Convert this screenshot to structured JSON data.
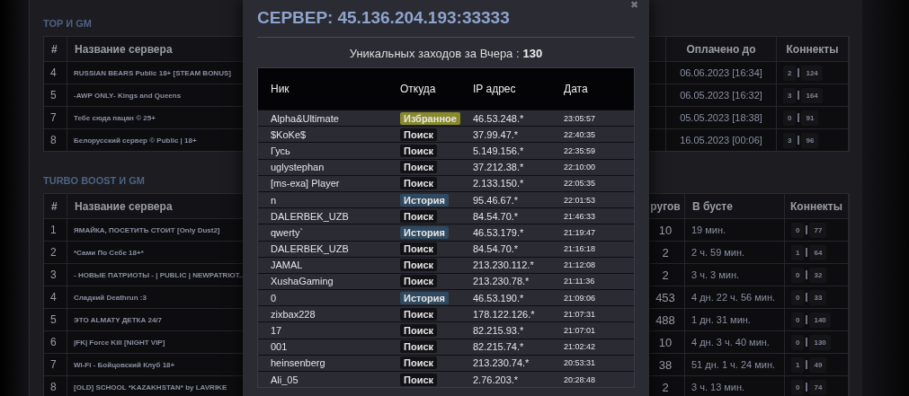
{
  "sections": [
    {
      "title": "TOP И GM",
      "columns": [
        "#",
        "Название сервера",
        "Оплачено до",
        "Коннекты"
      ],
      "rows": [
        {
          "num": "4",
          "name": "RUSSIAN BEARS Public 18+ [STEAM BONUS]",
          "info": "06.06.2023 [16:34]",
          "conn_a": "2",
          "conn_b": "124"
        },
        {
          "num": "5",
          "name": "-AWP ONLY- Kings and Queens",
          "info": "06.05.2023 [16:32]",
          "conn_a": "3",
          "conn_b": "164"
        },
        {
          "num": "7",
          "name": "Тебе сюда пацан © 25+",
          "info": "05.05.2023 [18:38]",
          "conn_a": "0",
          "conn_b": "91"
        },
        {
          "num": "8",
          "name": "Белорусский сервер © Public | 18+",
          "info": "16.05.2023 [00:06]",
          "conn_a": "3",
          "conn_b": "96"
        }
      ]
    },
    {
      "title": "TURBO BOOST И GM",
      "columns": [
        "#",
        "Название сервера",
        "ругов",
        "В бусте",
        "Коннекты"
      ],
      "rows": [
        {
          "num": "1",
          "name": "ЯМАЙКА, ПОСЕТИТЬ СТОИТ [Only Dust2]",
          "count": "10",
          "info": "19 мин.",
          "conn_a": "0",
          "conn_b": "77"
        },
        {
          "num": "2",
          "name": "*Сами По Себе 18+*",
          "count": "2",
          "info": "2 ч. 59 мин.",
          "conn_a": "1",
          "conn_b": "64"
        },
        {
          "num": "3",
          "name": "- НОВЫЕ ПАТРИОТЫ - | PUBLIC | NEWPATRIOT..",
          "count": "2",
          "info": "3 ч. 3 мин.",
          "conn_a": "0",
          "conn_b": "32"
        },
        {
          "num": "4",
          "name": "Сладкий Deathrun :3",
          "count": "453",
          "info": "4 дн. 22 ч. 56 мин.",
          "conn_a": "0",
          "conn_b": "33"
        },
        {
          "num": "5",
          "name": "ЭТО ALMATY ДЕТКА 24/7",
          "count": "488",
          "info": "1 дн. 31 мин.",
          "conn_a": "0",
          "conn_b": "140"
        },
        {
          "num": "6",
          "name": "|FK| Force Kill [NIGHT VIP]",
          "count": "10",
          "info": "4 дн. 3 ч. 40 мин.",
          "conn_a": "0",
          "conn_b": "130"
        },
        {
          "num": "7",
          "name": "Wi-Fi - Бойцовский Клуб 18+",
          "count": "38",
          "info": "51 дн. 1 ч. 24 мин.",
          "conn_a": "1",
          "conn_b": "49"
        },
        {
          "num": "8",
          "name": "[OLD] SCHOOL *KAZAKHSTAN* by LAVRIKE",
          "count": "2",
          "info": "3 ч. 13 мин.",
          "conn_a": "0",
          "conn_b": "74"
        }
      ]
    }
  ],
  "modal": {
    "title": "СЕРВЕР: 45.136.204.193:33333",
    "close": "✖",
    "summary_label": "Уникальных заходов за Вчера :",
    "summary_value": "130",
    "columns": [
      "Ник",
      "Откуда",
      "IP адрес",
      "Дата"
    ],
    "rows": [
      {
        "nick": "Alpha&Ultimate",
        "source": "Избранное",
        "kind": "favorite",
        "ip": "46.53.248.*",
        "time": "23:05:57"
      },
      {
        "nick": "$KoKe$",
        "source": "Поиск",
        "kind": "search",
        "ip": "37.99.47.*",
        "time": "22:40:35"
      },
      {
        "nick": "Гусь",
        "source": "Поиск",
        "kind": "search",
        "ip": "5.149.156.*",
        "time": "22:35:59"
      },
      {
        "nick": "uglystephan",
        "source": "Поиск",
        "kind": "search",
        "ip": "37.212.38.*",
        "time": "22:10:00"
      },
      {
        "nick": "[ms-exa] Player",
        "source": "Поиск",
        "kind": "search",
        "ip": "2.133.150.*",
        "time": "22:05:35"
      },
      {
        "nick": "n",
        "source": "История",
        "kind": "history",
        "ip": "95.46.67.*",
        "time": "22:01:53"
      },
      {
        "nick": "DALERBEK_UZB",
        "source": "Поиск",
        "kind": "search",
        "ip": "84.54.70.*",
        "time": "21:46:33"
      },
      {
        "nick": "qwerty`",
        "source": "История",
        "kind": "history",
        "ip": "46.53.179.*",
        "time": "21:19:47"
      },
      {
        "nick": "DALERBEK_UZB",
        "source": "Поиск",
        "kind": "search",
        "ip": "84.54.70.*",
        "time": "21:16:18"
      },
      {
        "nick": "JAMAL",
        "source": "Поиск",
        "kind": "search",
        "ip": "213.230.112.*",
        "time": "21:12:08"
      },
      {
        "nick": "XushaGaming",
        "source": "Поиск",
        "kind": "search",
        "ip": "213.230.78.*",
        "time": "21:11:36"
      },
      {
        "nick": "0",
        "source": "История",
        "kind": "history",
        "ip": "46.53.190.*",
        "time": "21:09:06"
      },
      {
        "nick": "zixbax228",
        "source": "Поиск",
        "kind": "search",
        "ip": "178.122.126.*",
        "time": "21:07:31"
      },
      {
        "nick": "17",
        "source": "Поиск",
        "kind": "search",
        "ip": "82.215.93.*",
        "time": "21:07:01"
      },
      {
        "nick": "001",
        "source": "Поиск",
        "kind": "search",
        "ip": "82.215.74.*",
        "time": "21:02:42"
      },
      {
        "nick": "heinsenberg",
        "source": "Поиск",
        "kind": "search",
        "ip": "213.230.74.*",
        "time": "20:53:31"
      },
      {
        "nick": "Ali_05",
        "source": "Поиск",
        "kind": "search",
        "ip": "2.76.203.*",
        "time": "20:28:48"
      }
    ]
  }
}
